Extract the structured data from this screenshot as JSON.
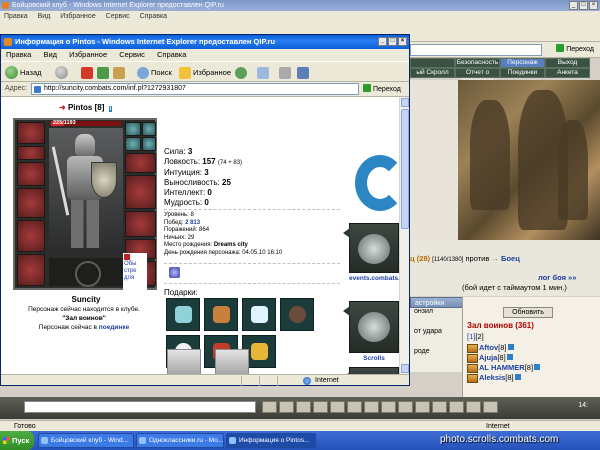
{
  "background_window": {
    "title": "Бойцовский клуб - Windows Internet Explorer предоставлен QIP.ru",
    "menu": [
      "Правка",
      "Вид",
      "Избранное",
      "Сервис",
      "Справка"
    ],
    "go_label": "Переход",
    "game_tabs_row1": [
      "",
      "Безопасность",
      "Персонаж",
      "Выход"
    ],
    "game_tabs_row2": [
      "ый Скролл",
      "Отчет о переводах",
      "Поединки",
      "Анкета"
    ],
    "battle": {
      "count_text": "ц (28)",
      "range_text": "[1140/1380]",
      "vs_text": "против",
      "opponent": "Боец",
      "log_link": "лог боя »»",
      "timeout_text": "(бой идет с таймаутом 1 мин.)"
    },
    "settings_tab": "астройки",
    "left_fragments": [
      "онзил",
      "от удара",
      "роде"
    ],
    "chat": {
      "refresh_label": "Обновить",
      "hall_title": "Зал воинов (361)",
      "pages": [
        "[1]",
        "[2]"
      ],
      "players": [
        {
          "name": "Aftov",
          "level": "[8]"
        },
        {
          "name": "Ajuja",
          "level": "[8]"
        },
        {
          "name": "AL HAMMER",
          "level": "[8]"
        },
        {
          "name": "Aleksis",
          "level": "[8]"
        }
      ]
    },
    "clock": "14:",
    "status_ready": "Готово",
    "status_zone": "Internet"
  },
  "taskbar": {
    "start_label": "Пуск",
    "tasks": [
      {
        "label": "Бойцовский клуб - Wind...",
        "active": false
      },
      {
        "label": "Одноклассники.ru - Мо...",
        "active": false
      },
      {
        "label": "Информация о Pintos...",
        "active": true
      }
    ]
  },
  "watermark": "photo.scrolls.combats.com",
  "popup": {
    "title": "Информация о Pintos - Windows Internet Explorer предоставлен QIP.ru",
    "menu": [
      "Правка",
      "Вид",
      "Избранное",
      "Сервис",
      "Справка"
    ],
    "toolbar": {
      "back": "Назад",
      "search": "Поиск",
      "favorites": "Избранное"
    },
    "address_label": "Адрес:",
    "url": "http://suncity.combats.com/inf.pl?1272931807",
    "go_label": "Переход",
    "status_zone": "Internet"
  },
  "character": {
    "name": "Pintos",
    "level": "[8]",
    "hp_text": "225/1193",
    "hp_fraction": 0.19,
    "city": "Suncity",
    "info_note": "Обы стре для",
    "location_prefix": "Персонаж сейчас находится в клубе.",
    "location_room": "\"Зал воинов\"",
    "fight_prefix": "Персонаж сейчас в",
    "fight_link": "поединке",
    "stats": [
      {
        "label": "Сила:",
        "value": "3",
        "extra": ""
      },
      {
        "label": "Ловкость:",
        "value": "157",
        "extra": "(74 + 83)"
      },
      {
        "label": "Интуиция:",
        "value": "3",
        "extra": ""
      },
      {
        "label": "Выносливость:",
        "value": "25",
        "extra": ""
      },
      {
        "label": "Интеллект:",
        "value": "0",
        "extra": ""
      },
      {
        "label": "Мудрость:",
        "value": "0",
        "extra": ""
      }
    ],
    "details": {
      "level_label": "Уровень:",
      "level_value": "8",
      "wins_label": "Побед:",
      "wins_value": "2 813",
      "losses_label": "Поражений:",
      "losses_value": "864",
      "draws_label": "Ничьих:",
      "draws_value": "29",
      "birthplace_label": "Место рождения:",
      "birthplace_value": "Dreams city",
      "birthday_label": "День рождения персонажа:",
      "birthday_value": "04.05.10 16:10"
    },
    "gifts_label": "Подарки:",
    "banner_labels": {
      "events": "events.combats.",
      "scrolls": "Scrolls"
    }
  }
}
